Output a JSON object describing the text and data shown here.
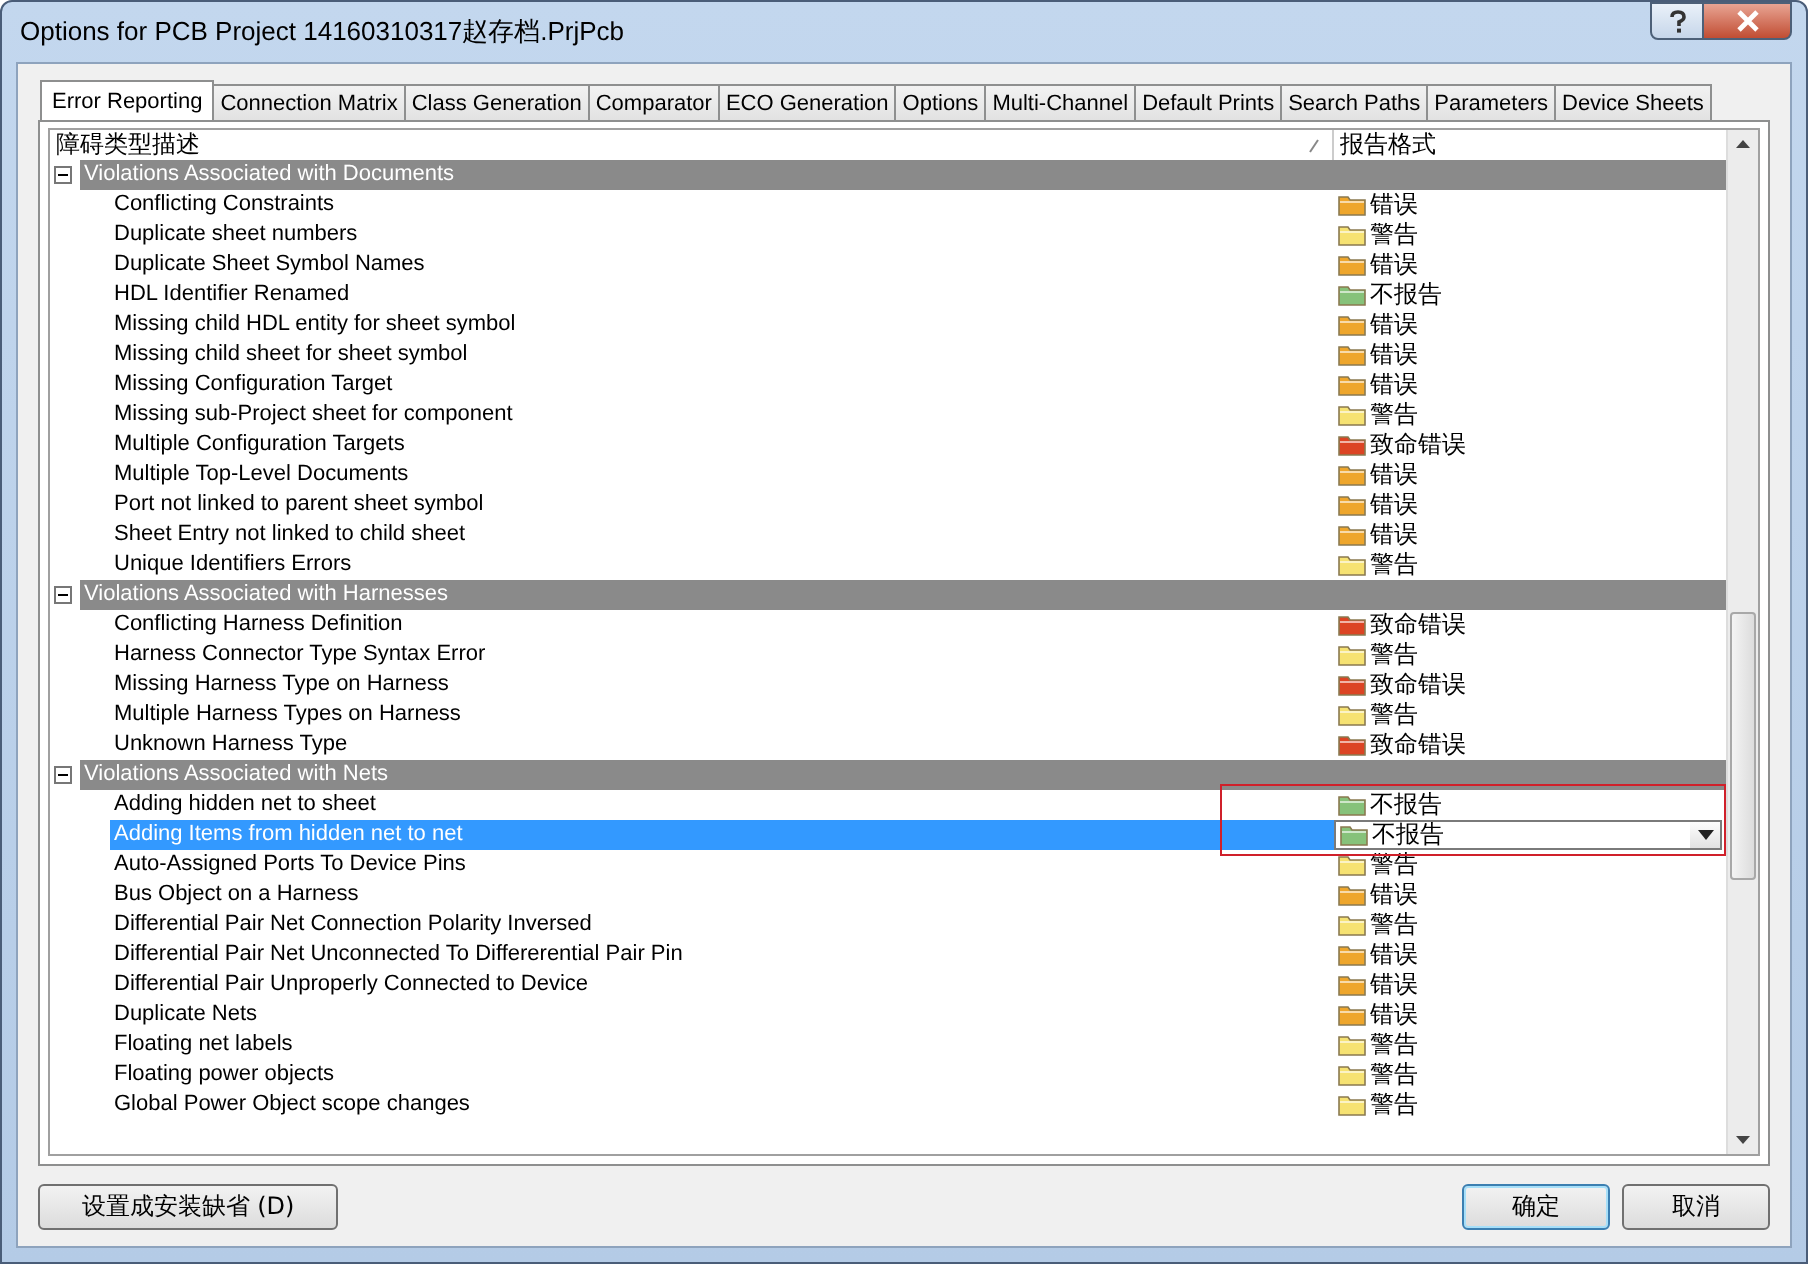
{
  "window": {
    "title": "Options for PCB Project 14160310317赵存档.PrjPcb"
  },
  "tabs": [
    {
      "label": "Error Reporting",
      "selected": true
    },
    {
      "label": "Connection Matrix",
      "selected": false
    },
    {
      "label": "Class Generation",
      "selected": false
    },
    {
      "label": "Comparator",
      "selected": false
    },
    {
      "label": "ECO Generation",
      "selected": false
    },
    {
      "label": "Options",
      "selected": false
    },
    {
      "label": "Multi-Channel",
      "selected": false
    },
    {
      "label": "Default Prints",
      "selected": false
    },
    {
      "label": "Search Paths",
      "selected": false
    },
    {
      "label": "Parameters",
      "selected": false
    },
    {
      "label": "Device Sheets",
      "selected": false
    }
  ],
  "table": {
    "columns": [
      "障碍类型描述",
      "报告格式"
    ],
    "groups": [
      {
        "label": "Violations Associated with Documents",
        "expanded": true,
        "rows": [
          {
            "name": "Conflicting Constraints",
            "kind": "error",
            "report": "错误",
            "selected": false,
            "annotated": false
          },
          {
            "name": "Duplicate sheet numbers",
            "kind": "warning",
            "report": "警告",
            "selected": false,
            "annotated": false
          },
          {
            "name": "Duplicate Sheet Symbol Names",
            "kind": "error",
            "report": "错误",
            "selected": false,
            "annotated": false
          },
          {
            "name": "HDL Identifier Renamed",
            "kind": "off",
            "report": "不报告",
            "selected": false,
            "annotated": false
          },
          {
            "name": "Missing child HDL entity for sheet symbol",
            "kind": "error",
            "report": "错误",
            "selected": false,
            "annotated": false
          },
          {
            "name": "Missing child sheet for sheet symbol",
            "kind": "error",
            "report": "错误",
            "selected": false,
            "annotated": false
          },
          {
            "name": "Missing Configuration Target",
            "kind": "error",
            "report": "错误",
            "selected": false,
            "annotated": false
          },
          {
            "name": "Missing sub-Project sheet for component",
            "kind": "warning",
            "report": "警告",
            "selected": false,
            "annotated": false
          },
          {
            "name": "Multiple Configuration Targets",
            "kind": "fatal",
            "report": "致命错误",
            "selected": false,
            "annotated": false
          },
          {
            "name": "Multiple Top-Level Documents",
            "kind": "error",
            "report": "错误",
            "selected": false,
            "annotated": false
          },
          {
            "name": "Port not linked to parent sheet symbol",
            "kind": "error",
            "report": "错误",
            "selected": false,
            "annotated": false
          },
          {
            "name": "Sheet Entry not linked to child sheet",
            "kind": "error",
            "report": "错误",
            "selected": false,
            "annotated": false
          },
          {
            "name": "Unique Identifiers Errors",
            "kind": "warning",
            "report": "警告",
            "selected": false,
            "annotated": false
          }
        ]
      },
      {
        "label": "Violations Associated with Harnesses",
        "expanded": true,
        "rows": [
          {
            "name": "Conflicting Harness Definition",
            "kind": "fatal",
            "report": "致命错误",
            "selected": false,
            "annotated": false
          },
          {
            "name": "Harness Connector Type Syntax Error",
            "kind": "warning",
            "report": "警告",
            "selected": false,
            "annotated": false
          },
          {
            "name": "Missing Harness Type on Harness",
            "kind": "fatal",
            "report": "致命错误",
            "selected": false,
            "annotated": false
          },
          {
            "name": "Multiple Harness Types on Harness",
            "kind": "warning",
            "report": "警告",
            "selected": false,
            "annotated": false
          },
          {
            "name": "Unknown Harness Type",
            "kind": "fatal",
            "report": "致命错误",
            "selected": false,
            "annotated": false
          }
        ]
      },
      {
        "label": "Violations Associated with Nets",
        "expanded": true,
        "rows": [
          {
            "name": "Adding hidden net to sheet",
            "kind": "off",
            "report": "不报告",
            "selected": false,
            "annotated": true
          },
          {
            "name": "Adding Items from hidden net to net",
            "kind": "off",
            "report": "不报告",
            "selected": true,
            "annotated": true
          },
          {
            "name": "Auto-Assigned Ports To Device Pins",
            "kind": "warning",
            "report": "警告",
            "selected": false,
            "annotated": false
          },
          {
            "name": "Bus Object on a Harness",
            "kind": "error",
            "report": "错误",
            "selected": false,
            "annotated": false
          },
          {
            "name": "Differential Pair Net Connection Polarity Inversed",
            "kind": "warning",
            "report": "警告",
            "selected": false,
            "annotated": false
          },
          {
            "name": "Differential Pair Net Unconnected To Differerential Pair Pin",
            "kind": "error",
            "report": "错误",
            "selected": false,
            "annotated": false
          },
          {
            "name": "Differential Pair Unproperly Connected to Device",
            "kind": "error",
            "report": "错误",
            "selected": false,
            "annotated": false
          },
          {
            "name": "Duplicate Nets",
            "kind": "error",
            "report": "错误",
            "selected": false,
            "annotated": false
          },
          {
            "name": "Floating net labels",
            "kind": "warning",
            "report": "警告",
            "selected": false,
            "annotated": false
          },
          {
            "name": "Floating power objects",
            "kind": "warning",
            "report": "警告",
            "selected": false,
            "annotated": false
          },
          {
            "name": "Global Power Object scope changes",
            "kind": "warning",
            "report": "警告",
            "selected": false,
            "annotated": false
          }
        ]
      }
    ]
  },
  "buttons": {
    "defaults": "设置成安装缺省 (D)",
    "ok": "确定",
    "cancel": "取消"
  }
}
